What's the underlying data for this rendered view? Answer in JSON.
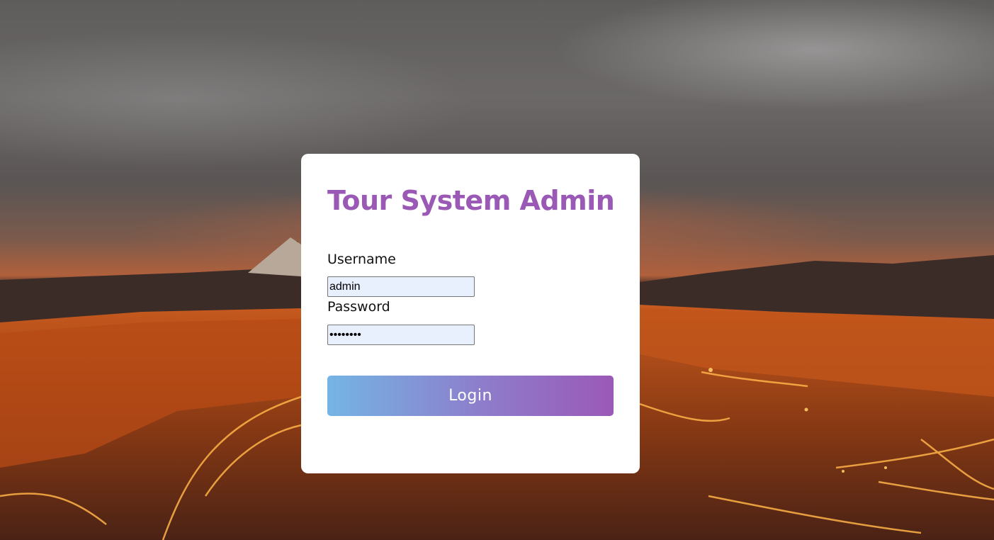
{
  "login": {
    "title": "Tour System Admin",
    "username_label": "Username",
    "username_value": "admin",
    "password_label": "Password",
    "password_value": "password",
    "login_button": "Login"
  },
  "colors": {
    "accent": "#9b59b6",
    "button_gradient_start": "#74b5e4",
    "button_gradient_end": "#9b59b6",
    "input_autofill_bg": "#e8f0fe"
  },
  "icons": {
    "background": "volcano-lava-landscape-image"
  }
}
